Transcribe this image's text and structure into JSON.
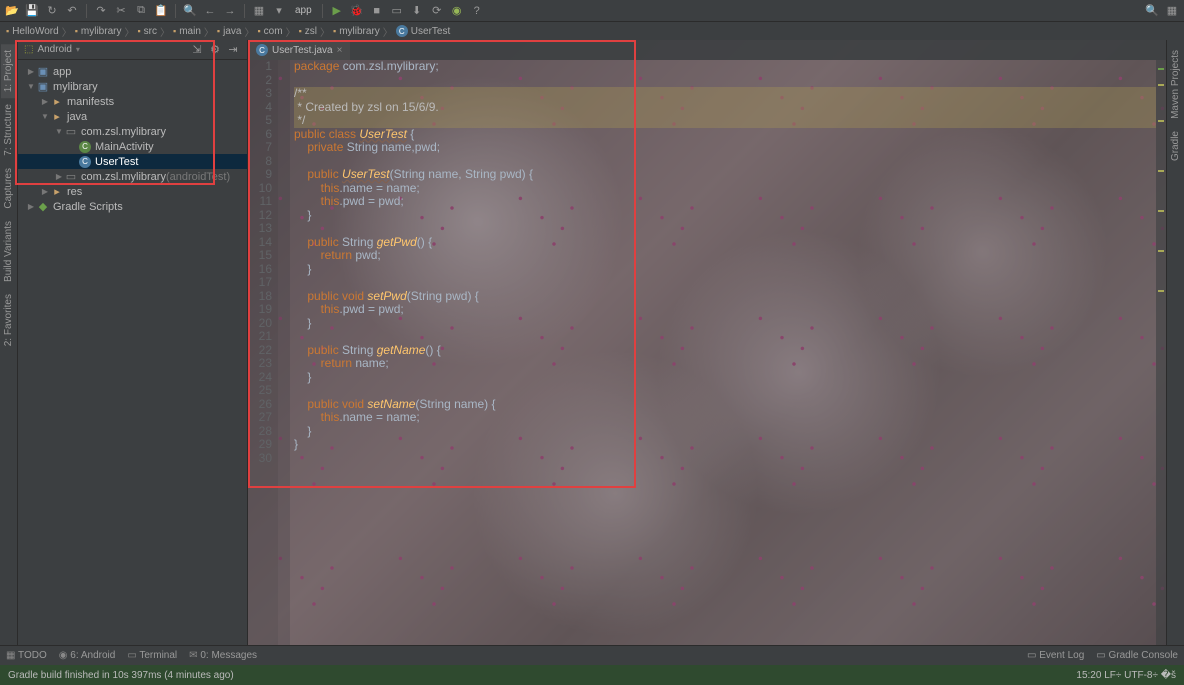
{
  "toolbar": {
    "icons": [
      "folder-open",
      "save",
      "sync",
      "undo",
      "redo",
      "cut",
      "copy",
      "paste",
      "find",
      "back",
      "forward",
      "build",
      "run-config",
      "run",
      "debug",
      "stop",
      "avd",
      "sdk",
      "sync2",
      "android",
      "help"
    ],
    "runconfig": "app"
  },
  "breadcrumb": [
    {
      "icon": "folder",
      "label": "HelloWord"
    },
    {
      "icon": "folder",
      "label": "mylibrary"
    },
    {
      "icon": "folder",
      "label": "src"
    },
    {
      "icon": "folder",
      "label": "main"
    },
    {
      "icon": "folder",
      "label": "java"
    },
    {
      "icon": "folder",
      "label": "com"
    },
    {
      "icon": "folder",
      "label": "zsl"
    },
    {
      "icon": "folder",
      "label": "mylibrary"
    },
    {
      "icon": "class",
      "label": "UserTest"
    }
  ],
  "left_tabs": [
    "1: Project",
    "7: Structure",
    "Captures",
    "Build Variants",
    "2: Favorites"
  ],
  "right_tabs": [
    "Maven Projects",
    "Gradle"
  ],
  "project_panel": {
    "title": "Android",
    "tree": [
      {
        "depth": 0,
        "arrow": "▶",
        "icon": "module",
        "label": "app"
      },
      {
        "depth": 0,
        "arrow": "▼",
        "icon": "module",
        "label": "mylibrary"
      },
      {
        "depth": 1,
        "arrow": "▶",
        "icon": "folder",
        "label": "manifests"
      },
      {
        "depth": 1,
        "arrow": "▼",
        "icon": "folder",
        "label": "java"
      },
      {
        "depth": 2,
        "arrow": "▼",
        "icon": "package",
        "label": "com.zsl.mylibrary"
      },
      {
        "depth": 3,
        "arrow": "",
        "icon": "class-a",
        "label": "MainActivity"
      },
      {
        "depth": 3,
        "arrow": "",
        "icon": "class",
        "label": "UserTest",
        "selected": true
      },
      {
        "depth": 2,
        "arrow": "▶",
        "icon": "package",
        "label": "com.zsl.mylibrary",
        "dim": "(androidTest)"
      },
      {
        "depth": 1,
        "arrow": "▶",
        "icon": "folder",
        "label": "res"
      },
      {
        "depth": 0,
        "arrow": "▶",
        "icon": "gradle",
        "label": "Gradle Scripts"
      }
    ]
  },
  "editor": {
    "tab": "UserTest.java",
    "lines": [
      {
        "n": 1,
        "t": [
          [
            "kw",
            "package "
          ],
          [
            "name",
            "com.zsl.mylibrary"
          ],
          [
            "name",
            ";"
          ]
        ]
      },
      {
        "n": 2,
        "t": []
      },
      {
        "n": 3,
        "t": [
          [
            "comment-hl",
            "/**"
          ]
        ]
      },
      {
        "n": 4,
        "t": [
          [
            "comment-hl",
            " * Created by zsl on 15/6/9."
          ]
        ]
      },
      {
        "n": 5,
        "t": [
          [
            "comment-hl",
            " */"
          ]
        ]
      },
      {
        "n": 6,
        "t": [
          [
            "kw",
            "public class "
          ],
          [
            "ident und",
            "UserTest"
          ],
          [
            "name",
            " {"
          ]
        ]
      },
      {
        "n": 7,
        "t": [
          [
            "name",
            "    "
          ],
          [
            "kw",
            "private "
          ],
          [
            "name",
            "String name,pwd;"
          ]
        ]
      },
      {
        "n": 8,
        "t": []
      },
      {
        "n": 9,
        "t": [
          [
            "name",
            "    "
          ],
          [
            "kw",
            "public "
          ],
          [
            "ident und",
            "UserTest"
          ],
          [
            "name",
            "(String name, String pwd) {"
          ]
        ]
      },
      {
        "n": 10,
        "t": [
          [
            "name",
            "        "
          ],
          [
            "kw",
            "this"
          ],
          [
            "name",
            ".name = name;"
          ]
        ]
      },
      {
        "n": 11,
        "t": [
          [
            "name",
            "        "
          ],
          [
            "kw",
            "this"
          ],
          [
            "name",
            ".pwd = pwd;"
          ]
        ]
      },
      {
        "n": 12,
        "t": [
          [
            "name",
            "    }"
          ]
        ]
      },
      {
        "n": 13,
        "t": []
      },
      {
        "n": 14,
        "t": [
          [
            "name",
            "    "
          ],
          [
            "kw",
            "public "
          ],
          [
            "name",
            "String "
          ],
          [
            "ident",
            "getPwd"
          ],
          [
            "name",
            "() {"
          ]
        ]
      },
      {
        "n": 15,
        "t": [
          [
            "name",
            "        "
          ],
          [
            "kw",
            "return "
          ],
          [
            "name",
            "pwd;"
          ]
        ]
      },
      {
        "n": 16,
        "t": [
          [
            "name",
            "    }"
          ]
        ]
      },
      {
        "n": 17,
        "t": []
      },
      {
        "n": 18,
        "t": [
          [
            "name",
            "    "
          ],
          [
            "kw",
            "public void "
          ],
          [
            "ident",
            "setPwd"
          ],
          [
            "name",
            "(String pwd) {"
          ]
        ]
      },
      {
        "n": 19,
        "t": [
          [
            "name",
            "        "
          ],
          [
            "kw",
            "this"
          ],
          [
            "name",
            ".pwd = pwd;"
          ]
        ]
      },
      {
        "n": 20,
        "t": [
          [
            "name",
            "    }"
          ]
        ]
      },
      {
        "n": 21,
        "t": []
      },
      {
        "n": 22,
        "t": [
          [
            "name",
            "    "
          ],
          [
            "kw",
            "public "
          ],
          [
            "name",
            "String "
          ],
          [
            "ident",
            "getName"
          ],
          [
            "name",
            "() {"
          ]
        ]
      },
      {
        "n": 23,
        "t": [
          [
            "name",
            "        "
          ],
          [
            "kw",
            "return "
          ],
          [
            "name",
            "name;"
          ]
        ]
      },
      {
        "n": 24,
        "t": [
          [
            "name",
            "    }"
          ]
        ]
      },
      {
        "n": 25,
        "t": []
      },
      {
        "n": 26,
        "t": [
          [
            "name",
            "    "
          ],
          [
            "kw",
            "public void "
          ],
          [
            "ident",
            "setName"
          ],
          [
            "name",
            "(String name) {"
          ]
        ]
      },
      {
        "n": 27,
        "t": [
          [
            "name",
            "        "
          ],
          [
            "kw",
            "this"
          ],
          [
            "name",
            ".name = name;"
          ]
        ]
      },
      {
        "n": 28,
        "t": [
          [
            "name",
            "    }"
          ]
        ]
      },
      {
        "n": 29,
        "t": [
          [
            "name",
            "}"
          ]
        ]
      },
      {
        "n": 30,
        "t": []
      }
    ]
  },
  "bottom_tabs": {
    "left": [
      "TODO",
      "6: Android",
      "Terminal",
      "0: Messages"
    ],
    "right": [
      "Event Log",
      "Gradle Console"
    ]
  },
  "statusbar": {
    "left": "Gradle build finished in 10s 397ms (4 minutes ago)",
    "right": "15:20  LF÷  UTF-8÷  �š"
  }
}
